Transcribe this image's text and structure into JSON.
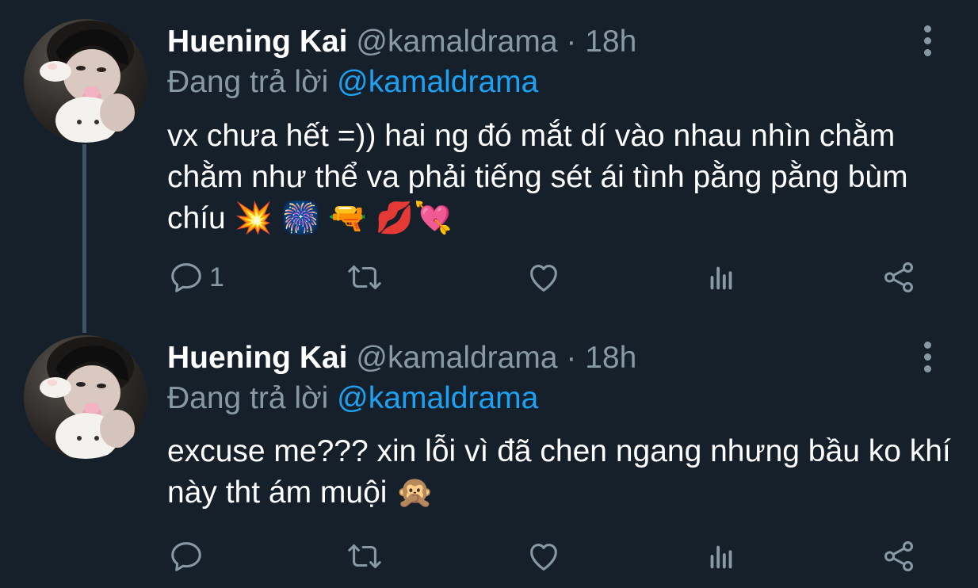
{
  "tweets": [
    {
      "author_name": "Huening Kai",
      "handle": "@kamaldrama",
      "separator": "·",
      "time": "18h",
      "reply_prefix": "Đang trả lời",
      "reply_target": "@kamaldrama",
      "text": "vx chưa hết =))  hai ng đó mắt dí vào nhau nhìn chằm chằm như thể va phải tiếng sét ái tình pằng pằng bùm chíu 💥 🎆  🔫 💋💘",
      "reply_count": "1",
      "retweet_count": "",
      "like_count": ""
    },
    {
      "author_name": "Huening Kai",
      "handle": "@kamaldrama",
      "separator": "·",
      "time": "18h",
      "reply_prefix": "Đang trả lời",
      "reply_target": "@kamaldrama",
      "text": "excuse me??? xin lỗi vì đã chen ngang nhưng bầu ko khí này tht ám muội 🙊",
      "reply_count": "",
      "retweet_count": "",
      "like_count": ""
    }
  ],
  "icons": {
    "reply": "reply-icon",
    "retweet": "retweet-icon",
    "like": "heart-icon",
    "stats": "analytics-icon",
    "share": "share-icon",
    "more": "more-vertical-icon"
  },
  "colors": {
    "background": "#15202b",
    "primary_text": "#ffffff",
    "secondary_text": "#8899a6",
    "link": "#1da1f2",
    "thread_line": "#3d5466"
  }
}
